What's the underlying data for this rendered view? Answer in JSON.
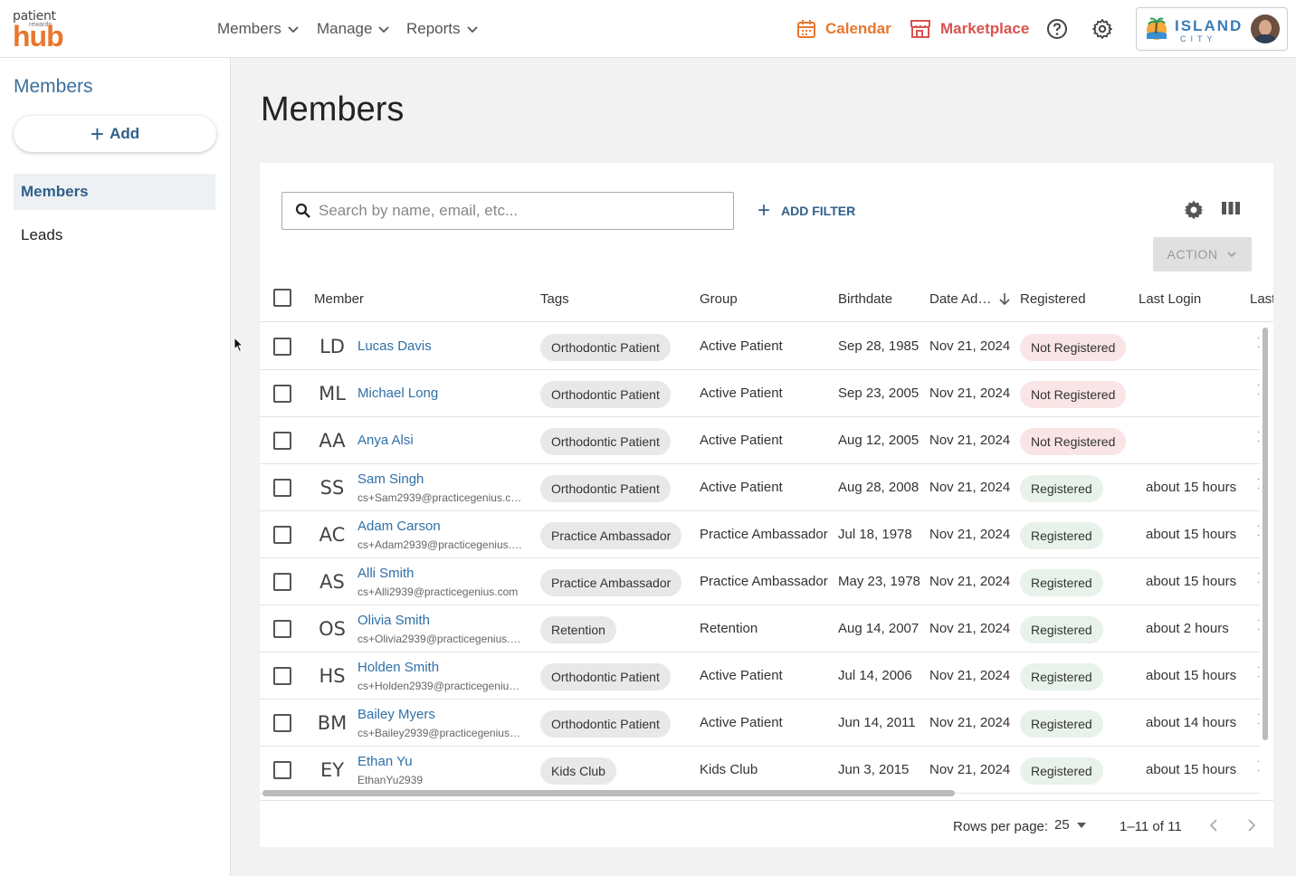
{
  "logo": {
    "line1": "patient",
    "line2": "rewards",
    "line3": "hub"
  },
  "nav": [
    {
      "label": "Members"
    },
    {
      "label": "Manage"
    },
    {
      "label": "Reports"
    }
  ],
  "top_links": {
    "calendar": "Calendar",
    "marketplace": "Marketplace"
  },
  "brand": {
    "name": "ISLAND",
    "sub": "CITY"
  },
  "sidebar": {
    "title": "Members",
    "add_label": "Add",
    "items": [
      {
        "label": "Members",
        "active": true
      },
      {
        "label": "Leads",
        "active": false
      }
    ]
  },
  "main": {
    "title": "Members",
    "search_placeholder": "Search by name, email, etc...",
    "add_filter_label": "ADD FILTER",
    "action_label": "ACTION"
  },
  "table": {
    "headers": {
      "member": "Member",
      "tags": "Tags",
      "group": "Group",
      "birthdate": "Birthdate",
      "date_added": "Date Ad…",
      "registered": "Registered",
      "last_login": "Last Login",
      "last": "Last"
    },
    "rows": [
      {
        "initials": "LD",
        "name": "Lucas Davis",
        "email": "",
        "tag": "Orthodontic Patient",
        "group": "Active Patient",
        "birthdate": "Sep 28, 1985",
        "date_added": "Nov 21, 2024",
        "registered": "Not Registered",
        "last_login": ""
      },
      {
        "initials": "ML",
        "name": "Michael Long",
        "email": "",
        "tag": "Orthodontic Patient",
        "group": "Active Patient",
        "birthdate": "Sep 23, 2005",
        "date_added": "Nov 21, 2024",
        "registered": "Not Registered",
        "last_login": ""
      },
      {
        "initials": "AA",
        "name": "Anya Alsi",
        "email": "",
        "tag": "Orthodontic Patient",
        "group": "Active Patient",
        "birthdate": "Aug 12, 2005",
        "date_added": "Nov 21, 2024",
        "registered": "Not Registered",
        "last_login": ""
      },
      {
        "initials": "SS",
        "name": "Sam Singh",
        "email": "cs+Sam2939@practicegenius.c…",
        "tag": "Orthodontic Patient",
        "group": "Active Patient",
        "birthdate": "Aug 28, 2008",
        "date_added": "Nov 21, 2024",
        "registered": "Registered",
        "last_login": "about 15 hours"
      },
      {
        "initials": "AC",
        "name": "Adam Carson",
        "email": "cs+Adam2939@practicegenius.…",
        "tag": "Practice Ambassador",
        "group": "Practice Ambassador",
        "birthdate": "Jul 18, 1978",
        "date_added": "Nov 21, 2024",
        "registered": "Registered",
        "last_login": "about 15 hours"
      },
      {
        "initials": "AS",
        "name": "Alli Smith",
        "email": "cs+Alli2939@practicegenius.com",
        "tag": "Practice Ambassador",
        "group": "Practice Ambassador",
        "birthdate": "May 23, 1978",
        "date_added": "Nov 21, 2024",
        "registered": "Registered",
        "last_login": "about 15 hours"
      },
      {
        "initials": "OS",
        "name": "Olivia Smith",
        "email": "cs+Olivia2939@practicegenius.…",
        "tag": "Retention",
        "group": "Retention",
        "birthdate": "Aug 14, 2007",
        "date_added": "Nov 21, 2024",
        "registered": "Registered",
        "last_login": "about 2 hours"
      },
      {
        "initials": "HS",
        "name": "Holden Smith",
        "email": "cs+Holden2939@practicegeniu…",
        "tag": "Orthodontic Patient",
        "group": "Active Patient",
        "birthdate": "Jul 14, 2006",
        "date_added": "Nov 21, 2024",
        "registered": "Registered",
        "last_login": "about 15 hours"
      },
      {
        "initials": "BM",
        "name": "Bailey Myers",
        "email": "cs+Bailey2939@practicegenius…",
        "tag": "Orthodontic Patient",
        "group": "Active Patient",
        "birthdate": "Jun 14, 2011",
        "date_added": "Nov 21, 2024",
        "registered": "Registered",
        "last_login": "about 14 hours"
      },
      {
        "initials": "EY",
        "name": "Ethan Yu",
        "email": "EthanYu2939",
        "tag": "Kids Club",
        "group": "Kids Club",
        "birthdate": "Jun 3, 2015",
        "date_added": "Nov 21, 2024",
        "registered": "Registered",
        "last_login": "about 15 hours"
      }
    ]
  },
  "footer": {
    "rows_per_page_label": "Rows per page:",
    "rows_per_page_value": "25",
    "range": "1–11 of 11"
  },
  "colors": {
    "orange": "#e8772e",
    "red": "#d9534f",
    "blue": "#2f6fa8"
  }
}
